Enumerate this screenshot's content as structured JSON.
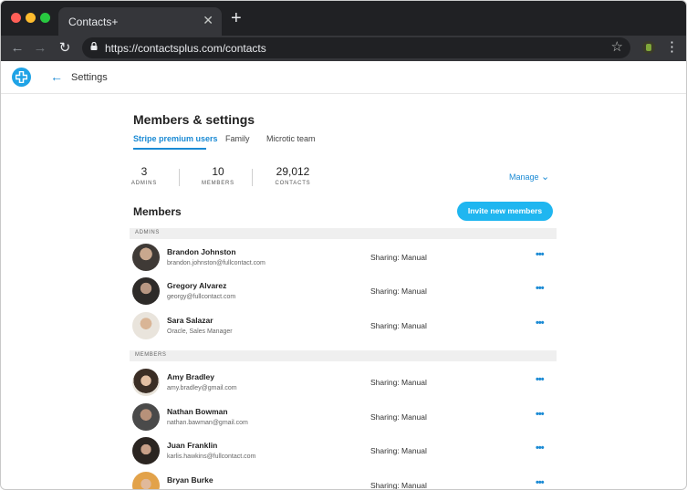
{
  "browser": {
    "tab_title": "Contacts+",
    "tab_close": "✕",
    "new_tab": "+",
    "url": "https://contactsplus.com/contacts"
  },
  "header": {
    "title": "Settings"
  },
  "page": {
    "title": "Members & settings",
    "tabs": [
      "Stripe premium users",
      "Family",
      "Microtic team"
    ],
    "active_tab": 0
  },
  "stats": [
    {
      "value": "3",
      "label": "ADMINS"
    },
    {
      "value": "10",
      "label": "MEMBERS"
    },
    {
      "value": "29,012",
      "label": "CONTACTS"
    }
  ],
  "manage_label": "Manage",
  "members_heading": "Members",
  "invite_button": "Invite new members",
  "sections": {
    "admins_label": "ADMINS",
    "members_label": "MEMBERS"
  },
  "admins": [
    {
      "name": "Brandon Johnston",
      "email": "brandon.johnston@fullcontact.com",
      "sharing": "Sharing: Manual",
      "more": "•••"
    },
    {
      "name": "Gregory Alvarez",
      "email": "georgy@fullcontact.com",
      "sharing": "Sharing: Manual",
      "more": "•••"
    },
    {
      "name": "Sara Salazar",
      "email": "Oracle, Sales Manager",
      "sharing": "Sharing: Manual",
      "more": "•••"
    }
  ],
  "members": [
    {
      "name": "Amy Bradley",
      "email": "amy.bradley@gmail.com",
      "sharing": "Sharing: Manual",
      "more": "•••"
    },
    {
      "name": "Nathan Bowman",
      "email": "nathan.bawman@gmail.com",
      "sharing": "Sharing: Manual",
      "more": "•••"
    },
    {
      "name": "Juan Franklin",
      "email": "karlis.hawkins@fullcontact.com",
      "sharing": "Sharing: Manual",
      "more": "•••"
    },
    {
      "name": "Bryan Burke",
      "email": "",
      "sharing": "Sharing: Manual",
      "more": "•••"
    }
  ],
  "colors": {
    "accent": "#1a8ad4",
    "button": "#1fb6f0",
    "chrome_dark": "#202124",
    "chrome_toolbar": "#35363a"
  }
}
